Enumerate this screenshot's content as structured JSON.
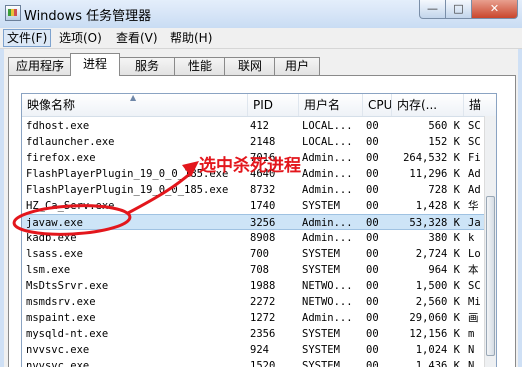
{
  "window": {
    "title": "Windows 任务管理器",
    "btn_min": "—",
    "btn_max": "□",
    "btn_close": "✕"
  },
  "menu": [
    {
      "label": "文件(F)"
    },
    {
      "label": "选项(O)"
    },
    {
      "label": "查看(V)"
    },
    {
      "label": "帮助(H)"
    }
  ],
  "tabs": [
    {
      "label": "应用程序"
    },
    {
      "label": "进程"
    },
    {
      "label": "服务"
    },
    {
      "label": "性能"
    },
    {
      "label": "联网"
    },
    {
      "label": "用户"
    }
  ],
  "selected_tab": "进程",
  "columns": [
    {
      "label": "映像名称"
    },
    {
      "label": "PID"
    },
    {
      "label": "用户名"
    },
    {
      "label": "CPU"
    },
    {
      "label": "内存(..."
    },
    {
      "label": "描"
    }
  ],
  "rows": [
    {
      "name": "fdhost.exe",
      "pid": "412",
      "user": "LOCAL...",
      "cpu": "00",
      "mem": "560 K",
      "desc": "SC"
    },
    {
      "name": "fdlauncher.exe",
      "pid": "2148",
      "user": "LOCAL...",
      "cpu": "00",
      "mem": "152 K",
      "desc": "SC"
    },
    {
      "name": "firefox.exe",
      "pid": "7016",
      "user": "Admin...",
      "cpu": "00",
      "mem": "264,532 K",
      "desc": "Fi"
    },
    {
      "name": "FlashPlayerPlugin_19_0_0_185.exe",
      "pid": "4640",
      "user": "Admin...",
      "cpu": "00",
      "mem": "11,296 K",
      "desc": "Ad"
    },
    {
      "name": "FlashPlayerPlugin_19_0_0_185.exe",
      "pid": "8732",
      "user": "Admin...",
      "cpu": "00",
      "mem": "728 K",
      "desc": "Ad"
    },
    {
      "name": "HZ_Ca_Serv.exe",
      "pid": "1740",
      "user": "SYSTEM",
      "cpu": "00",
      "mem": "1,428 K",
      "desc": "华"
    },
    {
      "name": "javaw.exe",
      "pid": "3256",
      "user": "Admin...",
      "cpu": "00",
      "mem": "53,328 K",
      "desc": "Ja"
    },
    {
      "name": "kadb.exe",
      "pid": "8908",
      "user": "Admin...",
      "cpu": "00",
      "mem": "380 K",
      "desc": "k"
    },
    {
      "name": "lsass.exe",
      "pid": "700",
      "user": "SYSTEM",
      "cpu": "00",
      "mem": "2,724 K",
      "desc": "Lo"
    },
    {
      "name": "lsm.exe",
      "pid": "708",
      "user": "SYSTEM",
      "cpu": "00",
      "mem": "964 K",
      "desc": "本"
    },
    {
      "name": "MsDtsSrvr.exe",
      "pid": "1988",
      "user": "NETWO...",
      "cpu": "00",
      "mem": "1,500 K",
      "desc": "SC"
    },
    {
      "name": "msmdsrv.exe",
      "pid": "2272",
      "user": "NETWO...",
      "cpu": "00",
      "mem": "2,560 K",
      "desc": "Mi"
    },
    {
      "name": "mspaint.exe",
      "pid": "1272",
      "user": "Admin...",
      "cpu": "00",
      "mem": "29,060 K",
      "desc": "画"
    },
    {
      "name": "mysqld-nt.exe",
      "pid": "2356",
      "user": "SYSTEM",
      "cpu": "00",
      "mem": "12,156 K",
      "desc": "m"
    },
    {
      "name": "nvvsvc.exe",
      "pid": "924",
      "user": "SYSTEM",
      "cpu": "00",
      "mem": "1,024 K",
      "desc": "N"
    },
    {
      "name": "nvvsvc.exe",
      "pid": "1520",
      "user": "SYSTEM",
      "cpu": "00",
      "mem": "1,436 K",
      "desc": "N"
    }
  ],
  "selected_row": "javaw.exe",
  "annotation": {
    "text": "选中杀死进程",
    "color": "#e3161c"
  },
  "colors": {
    "selection": "#cde4f7",
    "title_bar": "#c9dcf3",
    "annotation": "#e3161c"
  }
}
